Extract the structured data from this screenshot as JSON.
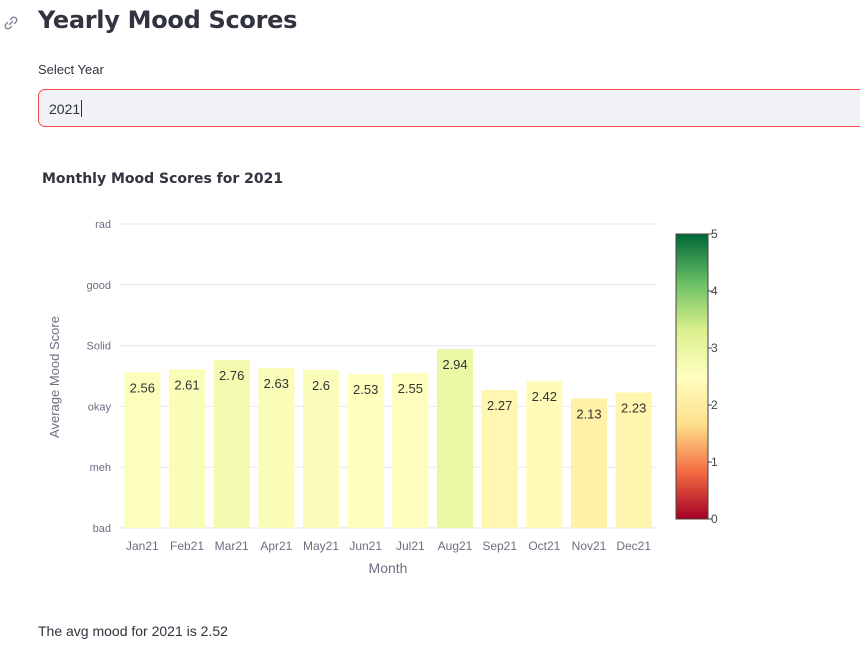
{
  "header": {
    "title": "Yearly Mood Scores",
    "link_icon": "link-icon"
  },
  "year_select": {
    "label": "Select Year",
    "value": "2021"
  },
  "summary": {
    "text": "The avg mood for 2021 is 2.52"
  },
  "chart_data": {
    "type": "bar",
    "title": "Monthly Mood Scores for 2021",
    "xlabel": "Month",
    "ylabel": "Average Mood Score",
    "categories": [
      "Jan21",
      "Feb21",
      "Mar21",
      "Apr21",
      "May21",
      "Jun21",
      "Jul21",
      "Aug21",
      "Sep21",
      "Oct21",
      "Nov21",
      "Dec21"
    ],
    "values": [
      2.56,
      2.61,
      2.76,
      2.63,
      2.6,
      2.53,
      2.55,
      2.94,
      2.27,
      2.42,
      2.13,
      2.23
    ],
    "value_labels": [
      "2.56",
      "2.61",
      "2.76",
      "2.63",
      "2.6",
      "2.53",
      "2.55",
      "2.94",
      "2.27",
      "2.42",
      "2.13",
      "2.23"
    ],
    "ylim": [
      0,
      5
    ],
    "yticks": [
      0,
      1,
      2,
      3,
      4,
      5
    ],
    "ytick_labels": [
      "bad",
      "meh",
      "okay",
      "Solid",
      "good",
      "rad"
    ],
    "grid": true,
    "colorbar": {
      "range": [
        0,
        5
      ],
      "ticks": [
        0,
        1,
        2,
        3,
        4,
        5
      ],
      "colors": [
        "#a50026",
        "#f46d43",
        "#fee08b",
        "#ffffbf",
        "#d9ef8b",
        "#66bd63",
        "#006837"
      ]
    }
  }
}
